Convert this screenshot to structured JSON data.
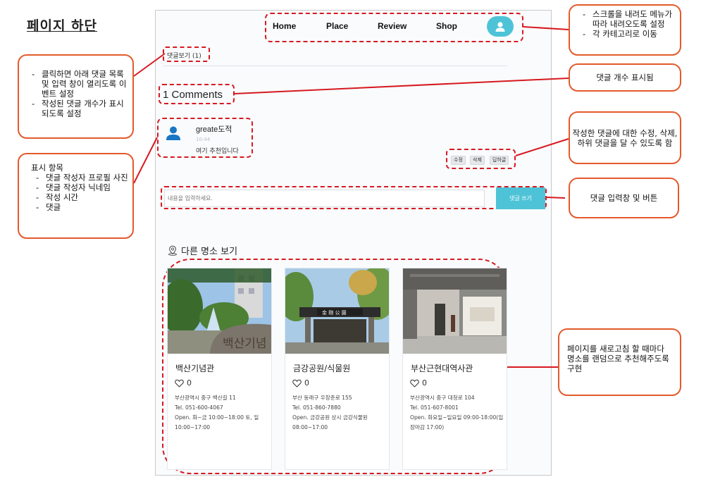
{
  "page_heading": "페이지 하단",
  "nav": {
    "items": [
      "Home",
      "Place",
      "Review",
      "Shop"
    ]
  },
  "comments": {
    "toggle_label": "댓글보기 (1)",
    "count_label": "1 Comments",
    "item": {
      "author": "greate도적",
      "time": "10:44",
      "body": "여기 추천입니다"
    },
    "actions": [
      "수정",
      "삭제",
      "답하글"
    ]
  },
  "comment_form": {
    "placeholder": "내용을 입력하세요.",
    "submit_label": "댓글 쓰기"
  },
  "places": {
    "title": "다른 명소 보기",
    "cards": [
      {
        "name": "백산기념관",
        "likes": "0",
        "address": "부산광역시 중구 백산길 11",
        "tel": "Tel. 051-600-4067",
        "hours": "Open. 화~금 10:00~18:00 토, 일 10:00~17:00"
      },
      {
        "name": "금강공원/식물원",
        "likes": "0",
        "address": "부산 동래구 우장춘로 155",
        "tel": "Tel. 051-860-7880",
        "hours": "Open. 금강공원 상시 금강식물원 08:00~17:00"
      },
      {
        "name": "부산근현대역사관",
        "likes": "0",
        "address": "부산광역시 중구 대청로 104",
        "tel": "Tel. 051-607-8001",
        "hours": "Open. 화요일~일요일 09:00-18:00(입장마감 17:00)"
      }
    ]
  },
  "annotations": {
    "toggle_note": [
      "클릭하면 아래 댓글 목록 및 입력 창이 열리도록 이벤트 설정",
      "작성된 댓글 개수가 표시되도록 설정"
    ],
    "display_note": {
      "lead": "표시 항목",
      "items": [
        "댓글 작성자 프로필 사진",
        "댓글 작성자 닉네임",
        "작성 시간",
        "댓글"
      ]
    },
    "nav_note": [
      "스크롤을 내려도 메뉴가 따라 내려오도록 설정",
      "각 카테고리로 이동"
    ],
    "count_note": "댓글 개수 표시됨",
    "actions_note": "작성한 댓글에 대한 수정, 삭제, 하위 댓글을 달 수 있도록 함",
    "input_note": "댓글 입력창 및 버튼",
    "random_note": "페이지를 새로고침 할 때마다 명소를 랜덤으로 추천해주도록 구현"
  },
  "colors": {
    "accent": "#4ec3d7",
    "highlight": "#d71920",
    "callout": "#e35a2c"
  }
}
